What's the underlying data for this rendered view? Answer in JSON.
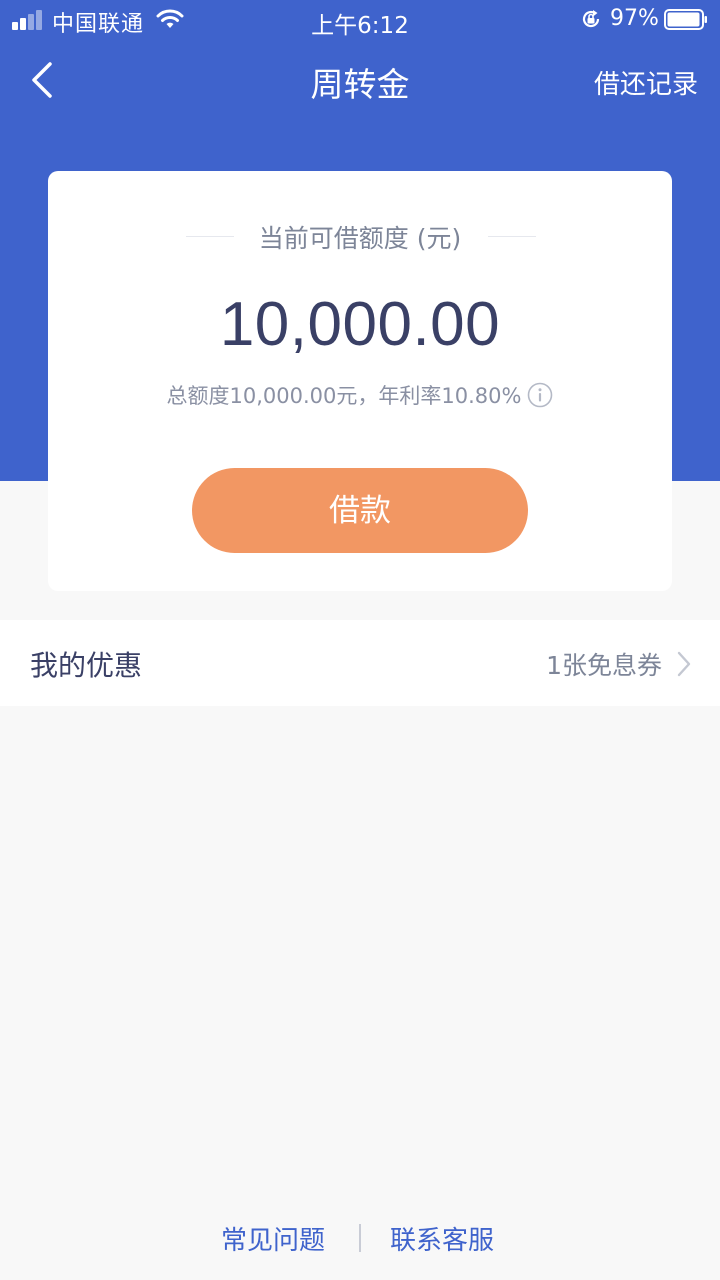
{
  "status_bar": {
    "carrier": "中国联通",
    "time": "上午6:12",
    "battery_percent": "97%",
    "battery_level": 0.97
  },
  "nav": {
    "title": "周转金",
    "right_action": "借还记录",
    "back_icon": "chevron-left-icon"
  },
  "credit_card": {
    "label": "当前可借额度 (元)",
    "amount": "10,000.00",
    "info_text": "总额度10,000.00元，年利率10.80%",
    "info_icon": "info-icon",
    "borrow_button": "借款"
  },
  "coupon": {
    "title": "我的优惠",
    "value": "1张免息券",
    "chevron_icon": "chevron-right-icon"
  },
  "footer": {
    "faq": "常见问题",
    "contact": "联系客服"
  },
  "colors": {
    "brand_blue": "#3f63cc",
    "button_orange": "#f29763",
    "amount_text": "#3a4066",
    "background": "#f8f8f8"
  }
}
